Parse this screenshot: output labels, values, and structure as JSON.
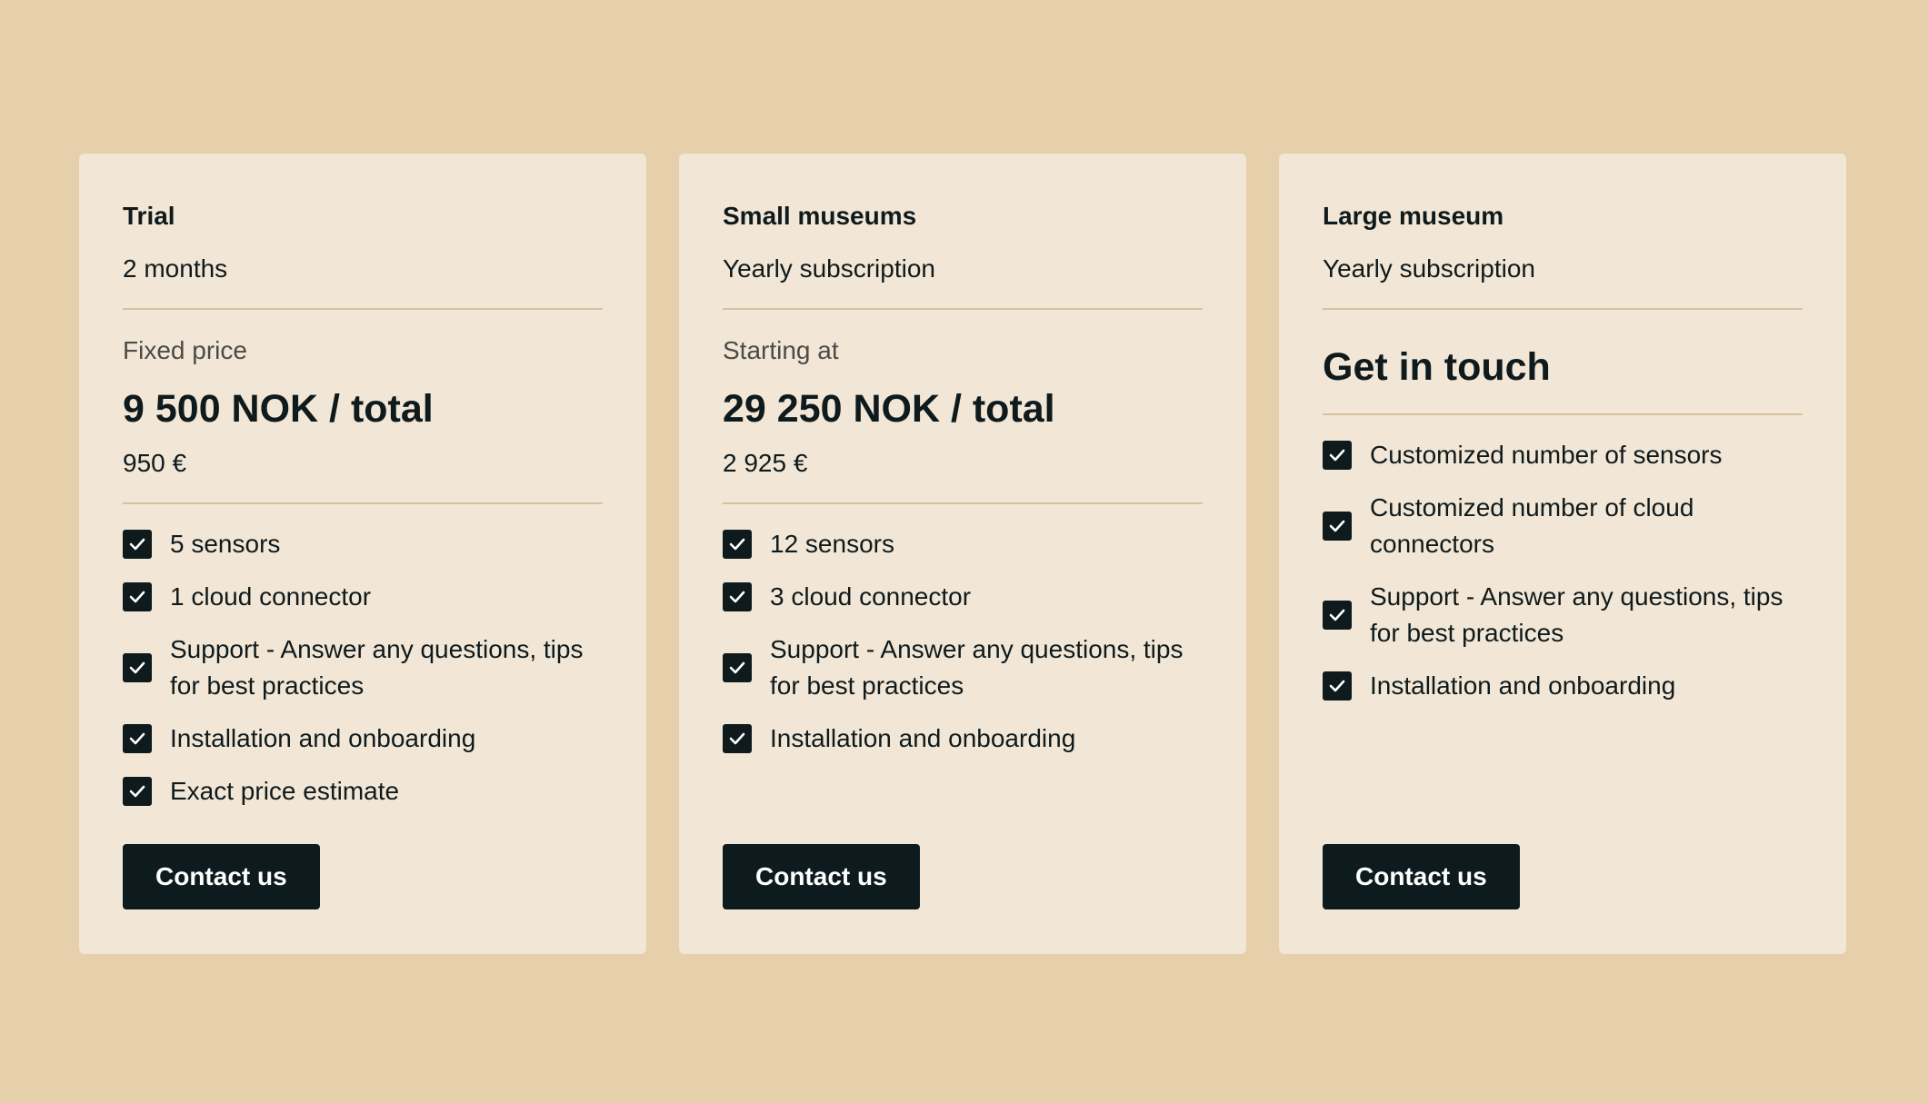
{
  "plans": [
    {
      "name": "Trial",
      "period": "2 months",
      "price_label": "Fixed price",
      "price": "9 500 NOK / total",
      "price_eur": "950 €",
      "features": [
        "5 sensors",
        "1 cloud connector",
        "Support - Answer any questions, tips for best practices",
        "Installation and onboarding",
        "Exact price estimate"
      ],
      "cta": "Contact us"
    },
    {
      "name": "Small museums",
      "period": "Yearly subscription",
      "price_label": "Starting at",
      "price": "29 250 NOK / total",
      "price_eur": "2 925 €",
      "features": [
        "12 sensors",
        "3 cloud connector",
        "Support - Answer any questions, tips for best practices",
        "Installation and onboarding"
      ],
      "cta": "Contact us"
    },
    {
      "name": "Large museum",
      "period": "Yearly subscription",
      "headline": "Get in touch",
      "features": [
        "Customized number of sensors",
        "Customized number of cloud connectors",
        "Support - Answer any questions, tips for best practices",
        "Installation and onboarding"
      ],
      "cta": "Contact us"
    }
  ],
  "icons": {
    "feature": "checkbox-checked-icon"
  },
  "colors": {
    "page_bg": "#e6cfab",
    "card_bg": "#f2e7d7",
    "button_bg": "#0d1b1e",
    "text": "#0f1a1c"
  }
}
